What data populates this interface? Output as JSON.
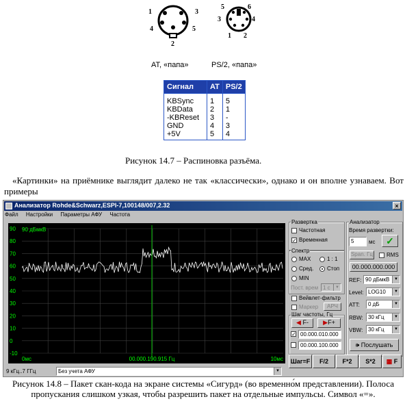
{
  "connectors": {
    "at": {
      "pins": [
        "1",
        "2",
        "3",
        "4",
        "5"
      ],
      "label": "AT, «папа»"
    },
    "ps2": {
      "pins": [
        "1",
        "2",
        "3",
        "4",
        "5",
        "6"
      ],
      "label": "PS/2, «папа»"
    }
  },
  "pin_table": {
    "headers": [
      "Сигнал",
      "AT",
      "PS/2"
    ],
    "rows": [
      [
        "KBSync",
        "1",
        "5"
      ],
      [
        "KBData",
        "2",
        "1"
      ],
      [
        "-KBReset",
        "3",
        "-"
      ],
      [
        "GND",
        "4",
        "3"
      ],
      [
        "+5V",
        "5",
        "4"
      ]
    ]
  },
  "caption_147": "Рисунок 14.7 – Распиновка разъёма.",
  "paragraph": "«Картинки» на приёмнике выглядит далеко не так «классически», однако и он вполне узнаваем. Вот примеры",
  "window": {
    "title": "Анализатор Rohde&Schwarz,ESPI-7,100148/007,2.32",
    "close": "×",
    "menu": [
      "Файл",
      "Настройки",
      "Параметры АФУ",
      "Частота"
    ],
    "plot": {
      "ref_label": "90 дБмкВ",
      "y_ticks": [
        "90",
        "80",
        "70",
        "60",
        "50",
        "40",
        "30",
        "20",
        "10",
        "0",
        "-10"
      ],
      "x_left": "0мс",
      "x_center": "00.000.190.915 Гц",
      "x_right": "10мс"
    },
    "sweep_group": {
      "title": "Развертка",
      "frequency": "Частотная",
      "time": "Временная",
      "time_checked": true
    },
    "spectrum_group": {
      "title": "Спектр",
      "max": "MAX",
      "ratio": "1 : 1",
      "avg": "Сред.",
      "stop": "Стоп",
      "min": "MIN",
      "post_label": "Пост. врем",
      "post_value": "1 с",
      "wavelet": "Вейвлет-фильтр",
      "marker": "Маркер",
      "afc": "АРЧ"
    },
    "step_group": {
      "title": "Шаг частоты, Гц",
      "minus": "F-",
      "plus": "F+",
      "step1": "00.000.010.000",
      "step2": "00.000.100.000"
    },
    "analyzer_group": {
      "title": "Анализатор",
      "sweep_time_label": "Время развертки:",
      "sweep_time_value": "5",
      "sweep_unit": "мс",
      "span_btn": "Span. Гц",
      "rms": "RMS",
      "freq_value": "00.000.000.000",
      "ref_label": "REF:",
      "ref_value": "90 дБмкВ",
      "level_label": "Level:",
      "level_value": "LOG10",
      "att_label": "ATT:",
      "att_value": "0 дБ",
      "rbw_label": "RBW:",
      "rbw_value": "30 кГц",
      "vbw_label": "VBW:",
      "vbw_value": "30 кГц",
      "listen": "Послушать"
    },
    "bottom_buttons": [
      "Шаг=F",
      "F/2",
      "F*2",
      "S*2",
      "F"
    ],
    "status": {
      "range": "9 кГц..7 ГГц",
      "antenna": "Без учета АФУ"
    }
  },
  "caption_148": "Рисунок 14.8 – Пакет скан-кода на экране системы «Сигурд» (во временно́м представлении). Полоса пропускания слишком узкая, чтобы разрешить пакет на отдельные импульсы. Символ «=»."
}
